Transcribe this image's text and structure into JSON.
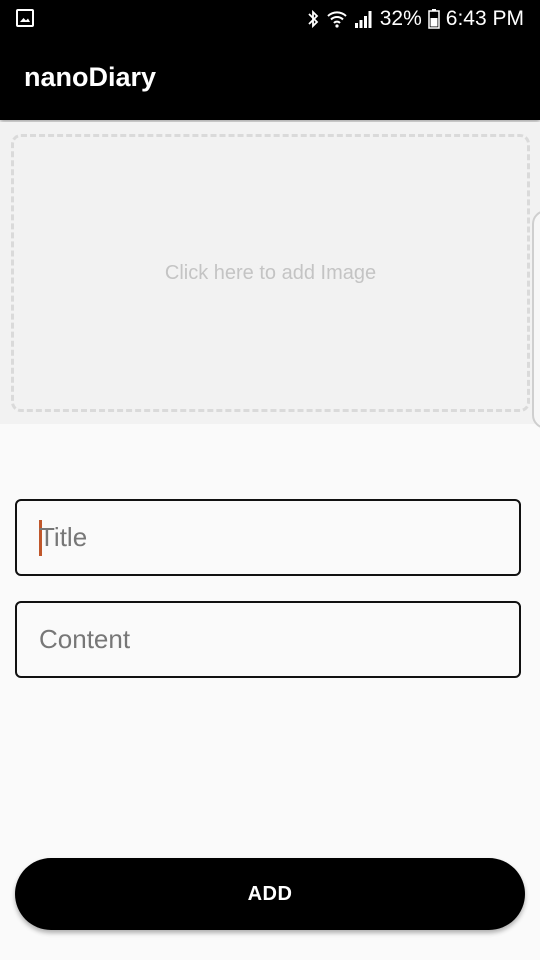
{
  "status_bar": {
    "left_icon": "image-notification-icon",
    "icons": [
      "bluetooth-icon",
      "wifi-icon",
      "signal-icon",
      "battery-icon"
    ],
    "battery_percent": "32%",
    "time": "6:43 PM"
  },
  "app_bar": {
    "title": "nanoDiary"
  },
  "image_picker": {
    "placeholder": "Click here to add Image"
  },
  "form": {
    "title_placeholder": "Title",
    "title_value": "",
    "content_placeholder": "Content",
    "content_value": ""
  },
  "actions": {
    "add_label": "ADD"
  },
  "colors": {
    "app_bar": "#000000",
    "background": "#fafafa",
    "image_area": "#f2f2f2",
    "cursor": "#c0572b",
    "button": "#000000"
  }
}
